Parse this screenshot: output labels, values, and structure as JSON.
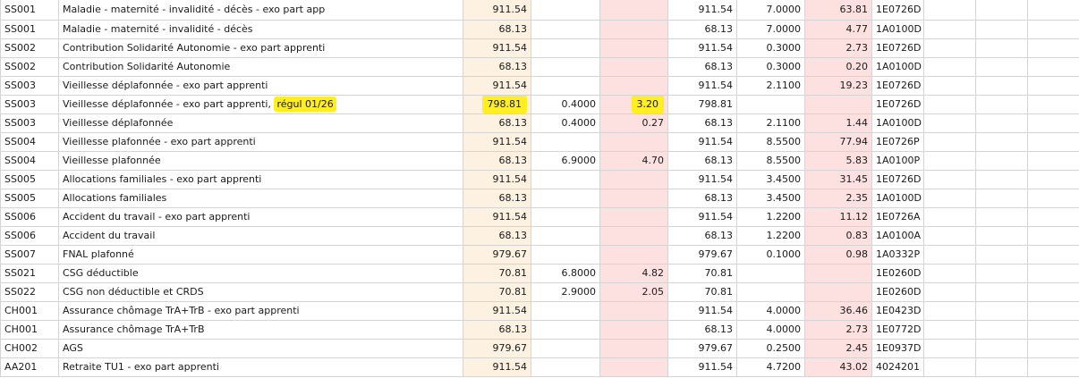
{
  "rows": [
    {
      "code": "SS001",
      "label": "Maladie - maternité - invalidité - décès - exo part app",
      "note": "",
      "base": "911.54",
      "sal_taux": "",
      "sal_montant": "",
      "base2": "911.54",
      "pat_taux": "7.0000",
      "pat_montant": "63.81",
      "ref": "1E0726D",
      "hl": false
    },
    {
      "code": "SS001",
      "label": "Maladie - maternité - invalidité - décès",
      "note": "",
      "base": "68.13",
      "sal_taux": "",
      "sal_montant": "",
      "base2": "68.13",
      "pat_taux": "7.0000",
      "pat_montant": "4.77",
      "ref": "1A0100D",
      "hl": false
    },
    {
      "code": "SS002",
      "label": "Contribution Solidarité Autonomie - exo part apprenti",
      "note": "",
      "base": "911.54",
      "sal_taux": "",
      "sal_montant": "",
      "base2": "911.54",
      "pat_taux": "0.3000",
      "pat_montant": "2.73",
      "ref": "1E0726D",
      "hl": false
    },
    {
      "code": "SS002",
      "label": "Contribution Solidarité Autonomie",
      "note": "",
      "base": "68.13",
      "sal_taux": "",
      "sal_montant": "",
      "base2": "68.13",
      "pat_taux": "0.3000",
      "pat_montant": "0.20",
      "ref": "1A0100D",
      "hl": false
    },
    {
      "code": "SS003",
      "label": "Vieillesse déplafonnée - exo part apprenti",
      "note": "",
      "base": "911.54",
      "sal_taux": "",
      "sal_montant": "",
      "base2": "911.54",
      "pat_taux": "2.1100",
      "pat_montant": "19.23",
      "ref": "1E0726D",
      "hl": false
    },
    {
      "code": "SS003",
      "label": "Vieillesse déplafonnée - exo part apprenti,",
      "note": "régul 01/26",
      "base": "798.81",
      "sal_taux": "0.4000",
      "sal_montant": "3.20",
      "base2": "798.81",
      "pat_taux": "",
      "pat_montant": "",
      "ref": "1E0726D",
      "hl": true
    },
    {
      "code": "SS003",
      "label": "Vieillesse déplafonnée",
      "note": "",
      "base": "68.13",
      "sal_taux": "0.4000",
      "sal_montant": "0.27",
      "base2": "68.13",
      "pat_taux": "2.1100",
      "pat_montant": "1.44",
      "ref": "1A0100D",
      "hl": false
    },
    {
      "code": "SS004",
      "label": "Vieillesse plafonnée - exo part apprenti",
      "note": "",
      "base": "911.54",
      "sal_taux": "",
      "sal_montant": "",
      "base2": "911.54",
      "pat_taux": "8.5500",
      "pat_montant": "77.94",
      "ref": "1E0726P",
      "hl": false
    },
    {
      "code": "SS004",
      "label": "Vieillesse plafonnée",
      "note": "",
      "base": "68.13",
      "sal_taux": "6.9000",
      "sal_montant": "4.70",
      "base2": "68.13",
      "pat_taux": "8.5500",
      "pat_montant": "5.83",
      "ref": "1A0100P",
      "hl": false
    },
    {
      "code": "SS005",
      "label": "Allocations familiales - exo part apprenti",
      "note": "",
      "base": "911.54",
      "sal_taux": "",
      "sal_montant": "",
      "base2": "911.54",
      "pat_taux": "3.4500",
      "pat_montant": "31.45",
      "ref": "1E0726D",
      "hl": false
    },
    {
      "code": "SS005",
      "label": "Allocations familiales",
      "note": "",
      "base": "68.13",
      "sal_taux": "",
      "sal_montant": "",
      "base2": "68.13",
      "pat_taux": "3.4500",
      "pat_montant": "2.35",
      "ref": "1A0100D",
      "hl": false
    },
    {
      "code": "SS006",
      "label": "Accident du travail - exo part apprenti",
      "note": "",
      "base": "911.54",
      "sal_taux": "",
      "sal_montant": "",
      "base2": "911.54",
      "pat_taux": "1.2200",
      "pat_montant": "11.12",
      "ref": "1E0726A",
      "hl": false
    },
    {
      "code": "SS006",
      "label": "Accident du travail",
      "note": "",
      "base": "68.13",
      "sal_taux": "",
      "sal_montant": "",
      "base2": "68.13",
      "pat_taux": "1.2200",
      "pat_montant": "0.83",
      "ref": "1A0100A",
      "hl": false
    },
    {
      "code": "SS007",
      "label": "FNAL plafonné",
      "note": "",
      "base": "979.67",
      "sal_taux": "",
      "sal_montant": "",
      "base2": "979.67",
      "pat_taux": "0.1000",
      "pat_montant": "0.98",
      "ref": "1A0332P",
      "hl": false
    },
    {
      "code": "SS021",
      "label": "CSG déductible",
      "note": "",
      "base": "70.81",
      "sal_taux": "6.8000",
      "sal_montant": "4.82",
      "base2": "70.81",
      "pat_taux": "",
      "pat_montant": "",
      "ref": "1E0260D",
      "hl": false
    },
    {
      "code": "SS022",
      "label": "CSG non déductible et CRDS",
      "note": "",
      "base": "70.81",
      "sal_taux": "2.9000",
      "sal_montant": "2.05",
      "base2": "70.81",
      "pat_taux": "",
      "pat_montant": "",
      "ref": "1E0260D",
      "hl": false
    },
    {
      "code": "CH001",
      "label": "Assurance chômage TrA+TrB - exo part apprenti",
      "note": "",
      "base": "911.54",
      "sal_taux": "",
      "sal_montant": "",
      "base2": "911.54",
      "pat_taux": "4.0000",
      "pat_montant": "36.46",
      "ref": "1E0423D",
      "hl": false
    },
    {
      "code": "CH001",
      "label": "Assurance chômage TrA+TrB",
      "note": "",
      "base": "68.13",
      "sal_taux": "",
      "sal_montant": "",
      "base2": "68.13",
      "pat_taux": "4.0000",
      "pat_montant": "2.73",
      "ref": "1E0772D",
      "hl": false
    },
    {
      "code": "CH002",
      "label": "AGS",
      "note": "",
      "base": "979.67",
      "sal_taux": "",
      "sal_montant": "",
      "base2": "979.67",
      "pat_taux": "0.2500",
      "pat_montant": "2.45",
      "ref": "1E0937D",
      "hl": false
    },
    {
      "code": "AA201",
      "label": "Retraite TU1 - exo part apprenti",
      "note": "",
      "base": "911.54",
      "sal_taux": "",
      "sal_montant": "",
      "base2": "911.54",
      "pat_taux": "4.7200",
      "pat_montant": "43.02",
      "ref": "4024201",
      "hl": false
    }
  ],
  "colors": {
    "base_fill": "#fdf1e2",
    "pat_fill": "#fde0e0",
    "highlight": "#ffee22",
    "grid": "#d4d4d4"
  }
}
